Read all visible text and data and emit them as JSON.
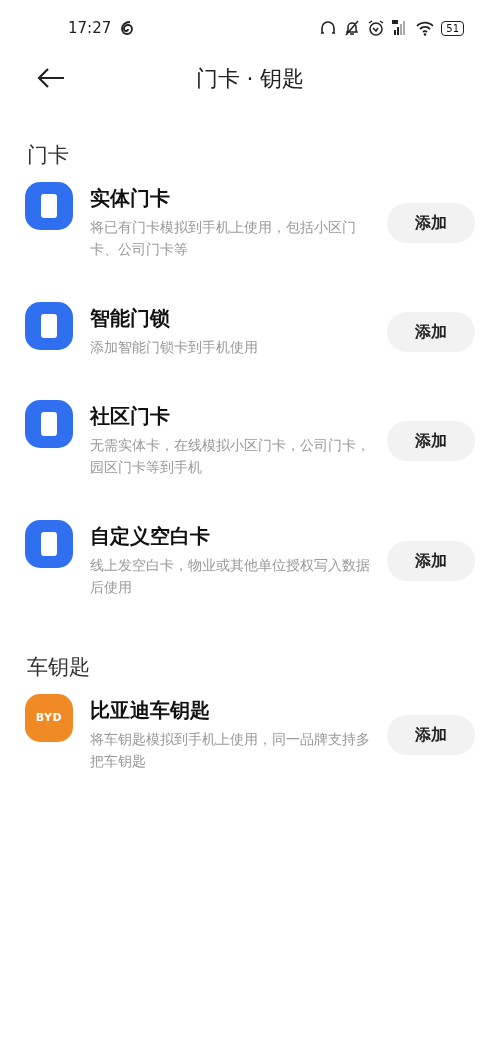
{
  "status_bar": {
    "time": "17:27",
    "battery": "51"
  },
  "header": {
    "title": "门卡 · 钥匙"
  },
  "sections": [
    {
      "title": "门卡",
      "items": [
        {
          "kind": "card",
          "title": "实体门卡",
          "description": "将已有门卡模拟到手机上使用，包括小区门卡、公司门卡等",
          "button": "添加"
        },
        {
          "kind": "card",
          "title": "智能门锁",
          "description": "添加智能门锁卡到手机使用",
          "button": "添加"
        },
        {
          "kind": "card",
          "title": "社区门卡",
          "description": "无需实体卡，在线模拟小区门卡，公司门卡，园区门卡等到手机",
          "button": "添加"
        },
        {
          "kind": "card",
          "title": "自定义空白卡",
          "description": "线上发空白卡，物业或其他单位授权写入数据后使用",
          "button": "添加"
        }
      ]
    },
    {
      "title": "车钥匙",
      "items": [
        {
          "kind": "car",
          "logo_text": "BYD",
          "title": "比亚迪车钥匙",
          "description": "将车钥匙模拟到手机上使用，同一品牌支持多把车钥匙",
          "button": "添加"
        }
      ]
    }
  ]
}
